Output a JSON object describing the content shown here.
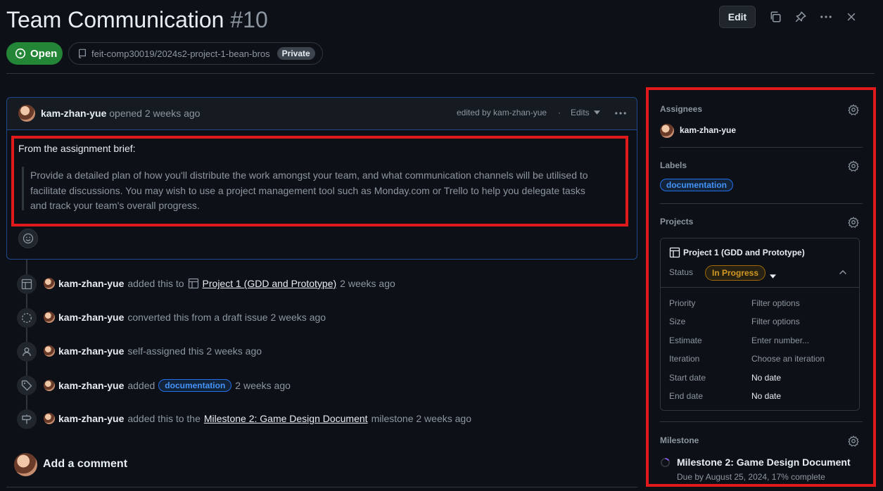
{
  "header": {
    "title": "Team Communication",
    "number": "#10",
    "edit_label": "Edit",
    "state": "Open",
    "repo": "feit-comp30019/2024s2-project-1-bean-bros",
    "visibility": "Private"
  },
  "comment": {
    "author": "kam-zhan-yue",
    "action": "opened 2 weeks ago",
    "edited_by": "edited by kam-zhan-yue",
    "separator": "·",
    "edits_label": "Edits",
    "intro": "From the assignment brief:",
    "quote_lines": [
      "Provide a detailed plan of how you'll distribute the work amongst your team, and what communication channels will be utilised to",
      "facilitate discussions. You may wish to use a project management tool such as Monday.com or Trello to help you delegate tasks",
      "and track your team's overall progress."
    ]
  },
  "timeline": [
    {
      "icon": "table-icon",
      "user": "kam-zhan-yue",
      "pre": "added this to",
      "link": "Project 1 (GDD and Prototype)",
      "post": "2 weeks ago"
    },
    {
      "icon": "draft-issue-icon",
      "user": "kam-zhan-yue",
      "pre": "converted this from a draft issue 2 weeks ago"
    },
    {
      "icon": "person-icon",
      "user": "kam-zhan-yue",
      "pre": "self-assigned this 2 weeks ago"
    },
    {
      "icon": "tag-icon",
      "user": "kam-zhan-yue",
      "pre": "added",
      "label": "documentation",
      "post": "2 weeks ago"
    },
    {
      "icon": "milestone-icon",
      "user": "kam-zhan-yue",
      "pre": "added this to the",
      "link": "Milestone 2: Game Design Document",
      "post": "milestone 2 weeks ago"
    }
  ],
  "add_comment": {
    "title": "Add a comment"
  },
  "sidebar": {
    "assignees": {
      "title": "Assignees",
      "user": "kam-zhan-yue"
    },
    "labels": {
      "title": "Labels",
      "label": "documentation"
    },
    "projects": {
      "title": "Projects",
      "project_name": "Project 1 (GDD and Prototype)",
      "status_label": "Status",
      "status_value": "In Progress",
      "fields": [
        {
          "name": "Priority",
          "value": "Filter options"
        },
        {
          "name": "Size",
          "value": "Filter options"
        },
        {
          "name": "Estimate",
          "value": "Enter number..."
        },
        {
          "name": "Iteration",
          "value": "Choose an iteration"
        },
        {
          "name": "Start date",
          "value": "No date"
        },
        {
          "name": "End date",
          "value": "No date"
        }
      ]
    },
    "milestone": {
      "title": "Milestone",
      "name": "Milestone 2: Game Design Document",
      "due": "Due by August 25, 2024, 17% complete",
      "progress": 0.17
    }
  },
  "colors": {
    "open": "#238636",
    "accent_blue": "#4493f8",
    "status": "#d29922",
    "highlight": "#e01a1a"
  }
}
